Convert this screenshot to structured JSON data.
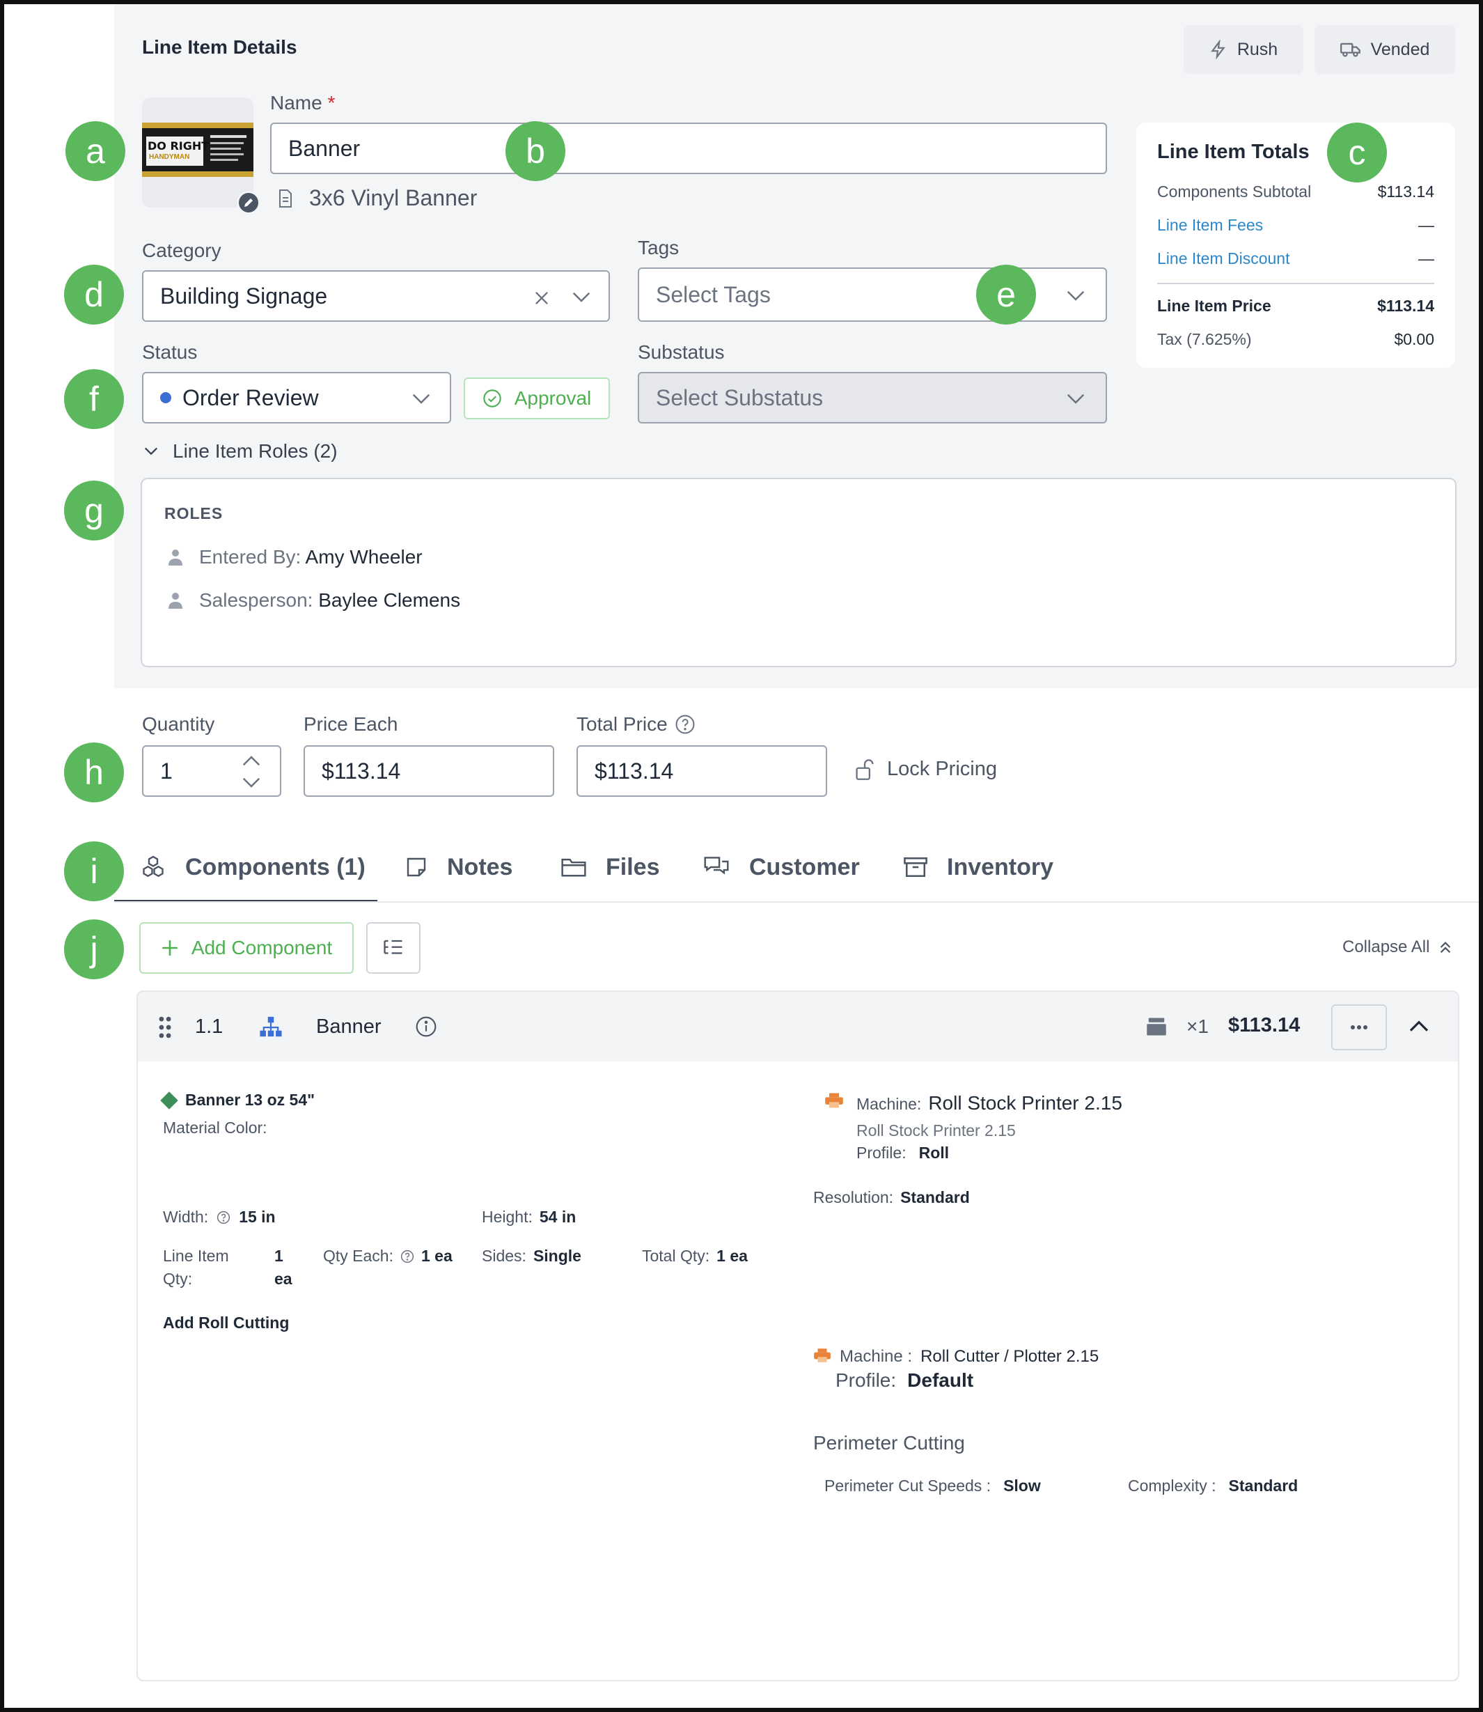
{
  "header": {
    "title": "Line Item Details",
    "rush_label": "Rush",
    "vended_label": "Vended"
  },
  "thumbnail": {
    "logo_line1": "DO RIGHT",
    "logo_line2": "HANDYMAN"
  },
  "name_field": {
    "label": "Name",
    "required_mark": "*",
    "value": "Banner",
    "product_name": "3x6 Vinyl Banner"
  },
  "totals": {
    "title": "Line Item Totals",
    "components_subtotal_label": "Components Subtotal",
    "components_subtotal_value": "$113.14",
    "fees_label": "Line Item Fees",
    "fees_value": "—",
    "discount_label": "Line Item Discount",
    "discount_value": "—",
    "price_label": "Line Item Price",
    "price_value": "$113.14",
    "tax_label": "Tax (7.625%)",
    "tax_value": "$0.00"
  },
  "category": {
    "label": "Category",
    "value": "Building Signage"
  },
  "tags": {
    "label": "Tags",
    "placeholder": "Select Tags"
  },
  "status": {
    "label": "Status",
    "value": "Order Review",
    "dot_color": "#3b6fd6",
    "approval_label": "Approval"
  },
  "substatus": {
    "label": "Substatus",
    "placeholder": "Select Substatus"
  },
  "roles": {
    "toggle_label": "Line Item Roles (2)",
    "heading": "ROLES",
    "items": [
      {
        "role": "Entered By:",
        "person": "Amy Wheeler"
      },
      {
        "role": "Salesperson:",
        "person": "Baylee Clemens"
      }
    ]
  },
  "pricing": {
    "quantity_label": "Quantity",
    "quantity_value": "1",
    "price_each_label": "Price Each",
    "price_each_value": "$113.14",
    "total_price_label": "Total Price",
    "total_price_value": "$113.14",
    "lock_label": "Lock Pricing"
  },
  "tabs": [
    {
      "label": "Components (1)",
      "icon": "components-icon"
    },
    {
      "label": "Notes",
      "icon": "note-icon"
    },
    {
      "label": "Files",
      "icon": "folder-icon"
    },
    {
      "label": "Customer",
      "icon": "chat-icon"
    },
    {
      "label": "Inventory",
      "icon": "archive-icon"
    }
  ],
  "toolbar": {
    "add_component_label": "Add Component",
    "collapse_all_label": "Collapse All"
  },
  "component": {
    "index": "1.1",
    "name": "Banner",
    "quantity": "×1",
    "price": "$113.14",
    "material_name": "Banner 13 oz 54\"",
    "material_color_label": "Material Color:",
    "machine_label": "Machine:",
    "machine_value": "Roll Stock Printer 2.15",
    "machine_sub": "Roll Stock Printer 2.15",
    "profile_label": "Profile:",
    "profile_value": "Roll",
    "resolution_label": "Resolution:",
    "resolution_value": "Standard",
    "width_label": "Width:",
    "width_value": "15 in",
    "height_label": "Height:",
    "height_value": "54 in",
    "line_item_qty_label1": "Line Item",
    "line_item_qty_label2": "Qty:",
    "line_item_qty_value1": "1",
    "line_item_qty_value2": "ea",
    "qty_each_label": "Qty Each:",
    "qty_each_value": "1 ea",
    "sides_label": "Sides:",
    "sides_value": "Single",
    "total_qty_label": "Total Qty:",
    "total_qty_value": "1 ea",
    "add_roll_cutting_label": "Add Roll Cutting",
    "cutter_machine_label": "Machine :",
    "cutter_machine_value": "Roll Cutter / Plotter 2.15",
    "cutter_profile_label": "Profile:",
    "cutter_profile_value": "Default",
    "perimeter_title": "Perimeter Cutting",
    "perimeter_speed_label": "Perimeter Cut Speeds :",
    "perimeter_speed_value": "Slow",
    "complexity_label": "Complexity :",
    "complexity_value": "Standard"
  },
  "annotations": [
    "a",
    "b",
    "c",
    "d",
    "e",
    "f",
    "g",
    "h",
    "i",
    "j"
  ],
  "colors": {
    "accent_green": "#5cb85c",
    "link_blue": "#2b87c8",
    "approval_green": "#4caf50"
  }
}
